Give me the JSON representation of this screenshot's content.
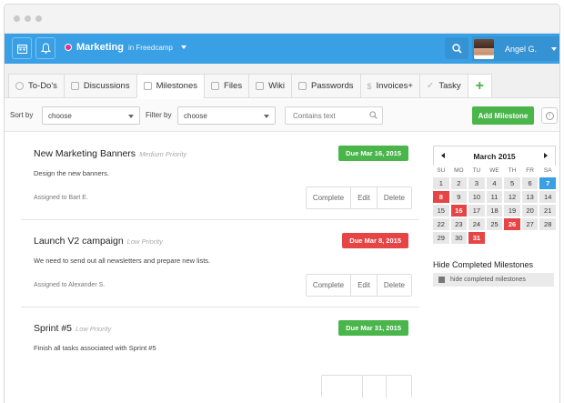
{
  "topbar": {
    "project_name": "Marketing",
    "project_sub": "in Freedcamp",
    "user_name": "Angel G."
  },
  "tabs": [
    {
      "label": "To-Do's",
      "icon": "check-circle-icon"
    },
    {
      "label": "Discussions",
      "icon": "chat-icon"
    },
    {
      "label": "Milestones",
      "icon": "milestone-icon"
    },
    {
      "label": "Files",
      "icon": "folder-icon"
    },
    {
      "label": "Wiki",
      "icon": "book-icon"
    },
    {
      "label": "Passwords",
      "icon": "keypad-icon"
    },
    {
      "label": "Invoices+",
      "icon": "dollar-icon"
    },
    {
      "label": "Tasky",
      "icon": "check-icon"
    }
  ],
  "filters": {
    "sort_label": "Sort by",
    "sort_value": "choose",
    "filter_label": "Filter by",
    "filter_value": "choose",
    "search_placeholder": "Contains text",
    "add_label": "Add Milestone"
  },
  "milestones": [
    {
      "title": "New Marketing Banners",
      "priority": "Medium Priority",
      "due": "Due Mar 16, 2015",
      "due_color": "#49b54a",
      "description": "Design the new banners.",
      "assigned": "Assigned to Bart E.",
      "actions": [
        "Complete",
        "Edit",
        "Delete"
      ]
    },
    {
      "title": "Launch V2 campaign",
      "priority": "Low Priority",
      "due": "Due Mar 8, 2015",
      "due_color": "#e64545",
      "description": "We need to send out all newsletters and prepare new lists.",
      "assigned": "Assigned to Alexander S.",
      "actions": [
        "Complete",
        "Edit",
        "Delete"
      ]
    },
    {
      "title": "Sprint #5",
      "priority": "Low Priority",
      "due": "Due Mar 31, 2015",
      "due_color": "#49b54a",
      "description": "Finish all tasks associated with Sprint #5",
      "assigned": "",
      "actions": []
    }
  ],
  "calendar": {
    "month": "March 2015",
    "weekdays": [
      "SU",
      "MO",
      "TU",
      "WE",
      "TH",
      "FR",
      "SA"
    ],
    "highlighted_due_days": [
      8,
      16,
      26,
      31
    ],
    "today": 7
  },
  "sidebar": {
    "hide_title": "Hide Completed Milestones",
    "hide_label": "hide completed milestones"
  },
  "colors": {
    "brand_blue": "#3aa0e6",
    "green": "#49b54a",
    "red": "#e64545"
  }
}
